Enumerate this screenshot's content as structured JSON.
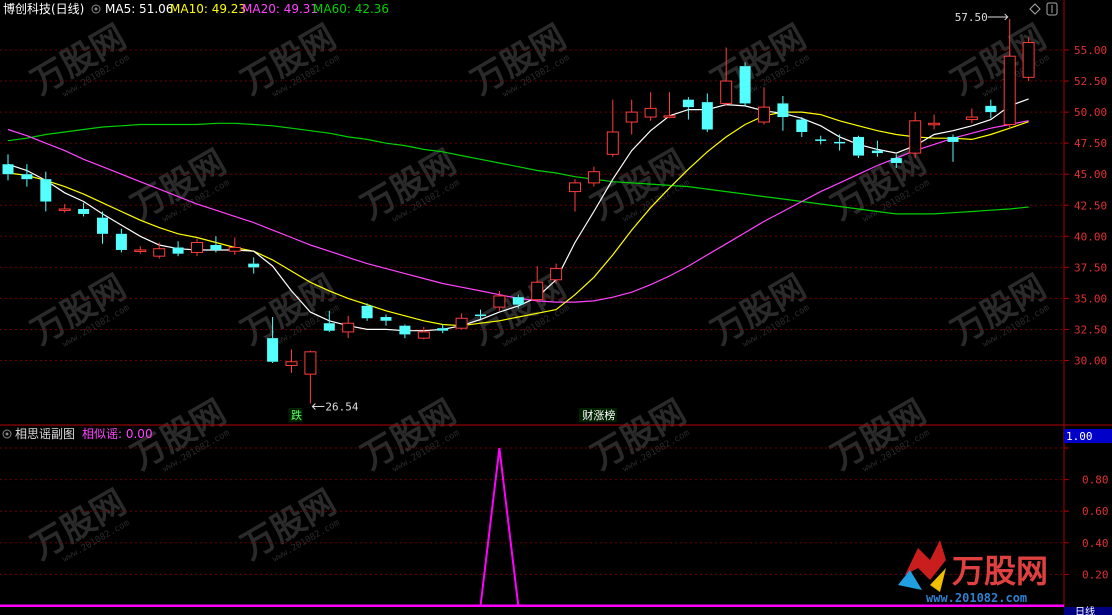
{
  "header": {
    "stock_title": "博创科技(日线)",
    "ma5_label": "MA5: 51.06",
    "ma10_label": "MA10: 49.23",
    "ma20_label": "MA20: 49.31",
    "ma60_label": "MA60: 42.36"
  },
  "sub_header": {
    "title": "相思谣副图",
    "value_label": "相似谣: 0.00"
  },
  "footer": {
    "period_label": "日线"
  },
  "watermark": {
    "brand": "万股网",
    "url": "www.201082.com"
  },
  "colors": {
    "background": "#000000",
    "up": "#ff3c3c",
    "down": "#54ffff",
    "ma5": "#ffffff",
    "ma10": "#ffff00",
    "ma20": "#ff44ff",
    "ma60": "#00d200",
    "axis_red": "#b00000",
    "sub_line": "#ff00ff"
  },
  "chart_data": [
    {
      "type": "candlestick",
      "title": "博创科技(日线)",
      "y_ticks": [
        "55.00",
        "52.50",
        "50.00",
        "47.50",
        "45.00",
        "42.50",
        "40.00",
        "37.50",
        "35.00",
        "32.50",
        "30.00"
      ],
      "ylim": [
        27.5,
        57.5
      ],
      "candles": [
        {
          "o": 45.8,
          "c": 45.0,
          "h": 46.6,
          "l": 44.5
        },
        {
          "o": 45.0,
          "c": 44.6,
          "h": 45.8,
          "l": 44.0
        },
        {
          "o": 44.6,
          "c": 42.8,
          "h": 45.2,
          "l": 42.0
        },
        {
          "o": 42.2,
          "c": 42.2,
          "h": 42.6,
          "l": 41.9
        },
        {
          "o": 42.2,
          "c": 41.8,
          "h": 42.7,
          "l": 41.6
        },
        {
          "o": 41.5,
          "c": 40.2,
          "h": 42.0,
          "l": 39.4
        },
        {
          "o": 40.2,
          "c": 38.9,
          "h": 40.6,
          "l": 38.7
        },
        {
          "o": 38.9,
          "c": 38.9,
          "h": 39.2,
          "l": 38.6
        },
        {
          "o": 38.4,
          "c": 39.0,
          "h": 39.5,
          "l": 38.2
        },
        {
          "o": 39.1,
          "c": 38.6,
          "h": 39.6,
          "l": 38.4
        },
        {
          "o": 38.7,
          "c": 39.5,
          "h": 39.8,
          "l": 38.4
        },
        {
          "o": 39.3,
          "c": 38.9,
          "h": 40.0,
          "l": 38.7
        },
        {
          "o": 38.8,
          "c": 39.1,
          "h": 39.9,
          "l": 38.5
        },
        {
          "o": 37.8,
          "c": 37.5,
          "h": 38.3,
          "l": 37.0
        },
        {
          "o": 31.8,
          "c": 29.9,
          "h": 33.5,
          "l": 29.8
        },
        {
          "o": 29.6,
          "c": 29.9,
          "h": 30.9,
          "l": 29.0
        },
        {
          "o": 28.9,
          "c": 30.7,
          "h": 30.8,
          "l": 26.54
        },
        {
          "o": 33.0,
          "c": 32.4,
          "h": 34.0,
          "l": 32.3
        },
        {
          "o": 32.3,
          "c": 33.0,
          "h": 33.6,
          "l": 31.8
        },
        {
          "o": 34.4,
          "c": 33.4,
          "h": 34.6,
          "l": 33.2
        },
        {
          "o": 33.5,
          "c": 33.2,
          "h": 33.7,
          "l": 32.8
        },
        {
          "o": 32.8,
          "c": 32.1,
          "h": 32.9,
          "l": 31.8
        },
        {
          "o": 31.8,
          "c": 32.3,
          "h": 32.7,
          "l": 31.7
        },
        {
          "o": 32.6,
          "c": 32.4,
          "h": 32.9,
          "l": 32.2
        },
        {
          "o": 32.6,
          "c": 33.4,
          "h": 33.8,
          "l": 32.5
        },
        {
          "o": 33.7,
          "c": 33.6,
          "h": 34.1,
          "l": 33.3
        },
        {
          "o": 34.3,
          "c": 35.2,
          "h": 35.6,
          "l": 34.0
        },
        {
          "o": 35.1,
          "c": 34.5,
          "h": 35.3,
          "l": 34.2
        },
        {
          "o": 34.9,
          "c": 36.3,
          "h": 37.6,
          "l": 34.7
        },
        {
          "o": 36.5,
          "c": 37.4,
          "h": 37.8,
          "l": 36.2
        },
        {
          "o": 43.6,
          "c": 44.3,
          "h": 44.6,
          "l": 42.0
        },
        {
          "o": 44.3,
          "c": 45.2,
          "h": 45.6,
          "l": 44.0
        },
        {
          "o": 46.6,
          "c": 48.4,
          "h": 51.0,
          "l": 46.4
        },
        {
          "o": 49.2,
          "c": 50.0,
          "h": 51.0,
          "l": 48.2
        },
        {
          "o": 49.6,
          "c": 50.3,
          "h": 51.6,
          "l": 49.3
        },
        {
          "o": 49.6,
          "c": 49.7,
          "h": 51.6,
          "l": 49.5
        },
        {
          "o": 51.0,
          "c": 50.4,
          "h": 51.2,
          "l": 49.4
        },
        {
          "o": 50.8,
          "c": 48.6,
          "h": 51.5,
          "l": 48.4
        },
        {
          "o": 50.7,
          "c": 52.5,
          "h": 55.2,
          "l": 50.5
        },
        {
          "o": 53.7,
          "c": 50.7,
          "h": 54.0,
          "l": 50.5
        },
        {
          "o": 49.2,
          "c": 50.4,
          "h": 52.0,
          "l": 49.0
        },
        {
          "o": 50.7,
          "c": 49.6,
          "h": 51.3,
          "l": 48.5
        },
        {
          "o": 49.4,
          "c": 48.4,
          "h": 49.6,
          "l": 48.0
        },
        {
          "o": 47.8,
          "c": 47.7,
          "h": 48.1,
          "l": 47.4
        },
        {
          "o": 47.6,
          "c": 47.5,
          "h": 48.2,
          "l": 46.9
        },
        {
          "o": 48.0,
          "c": 46.5,
          "h": 48.1,
          "l": 46.3
        },
        {
          "o": 46.9,
          "c": 46.7,
          "h": 47.7,
          "l": 46.4
        },
        {
          "o": 46.3,
          "c": 45.9,
          "h": 46.6,
          "l": 45.5
        },
        {
          "o": 46.7,
          "c": 49.3,
          "h": 50.0,
          "l": 46.3
        },
        {
          "o": 49.1,
          "c": 49.1,
          "h": 49.8,
          "l": 48.6
        },
        {
          "o": 48.0,
          "c": 47.6,
          "h": 48.2,
          "l": 46.0
        },
        {
          "o": 49.4,
          "c": 49.6,
          "h": 50.3,
          "l": 49.1
        },
        {
          "o": 50.5,
          "c": 50.0,
          "h": 51.0,
          "l": 49.5
        },
        {
          "o": 49.0,
          "c": 54.5,
          "h": 57.5,
          "l": 48.7
        },
        {
          "o": 52.8,
          "c": 55.6,
          "h": 56.0,
          "l": 52.5
        }
      ],
      "ma5": [
        45.8,
        45.3,
        44.5,
        43.5,
        42.8,
        41.8,
        40.9,
        40.0,
        39.3,
        39.0,
        38.9,
        38.9,
        38.9,
        38.8,
        37.6,
        35.6,
        33.9,
        33.2,
        32.8,
        32.5,
        32.5,
        32.4,
        32.4,
        32.5,
        32.8,
        33.3,
        33.9,
        34.4,
        35.1,
        36.5,
        39.5,
        42.0,
        44.6,
        46.9,
        48.5,
        49.7,
        50.2,
        50.2,
        50.6,
        50.5,
        50.1,
        49.9,
        49.5,
        48.9,
        48.0,
        47.4,
        47.0,
        46.7,
        47.3,
        48.2,
        48.5,
        48.9,
        49.4,
        50.5,
        51.06
      ],
      "ma10": [
        45.1,
        44.9,
        44.5,
        44.0,
        43.4,
        42.7,
        42.0,
        41.3,
        40.7,
        40.2,
        39.9,
        39.5,
        39.1,
        38.8,
        38.1,
        37.2,
        36.3,
        35.6,
        35.0,
        34.5,
        34.0,
        33.6,
        33.2,
        32.9,
        32.8,
        33.0,
        33.2,
        33.5,
        33.8,
        34.1,
        35.3,
        36.7,
        38.5,
        40.5,
        42.3,
        43.9,
        45.4,
        46.8,
        48.0,
        49.0,
        49.7,
        50.0,
        50.0,
        49.8,
        49.3,
        48.9,
        48.5,
        48.2,
        48.0,
        47.9,
        47.9,
        47.8,
        48.2,
        48.7,
        49.23
      ],
      "ma20": [
        48.6,
        48.1,
        47.5,
        46.9,
        46.2,
        45.6,
        45.0,
        44.4,
        43.8,
        43.2,
        42.6,
        42.1,
        41.6,
        41.1,
        40.5,
        39.9,
        39.3,
        38.8,
        38.3,
        37.8,
        37.4,
        37.0,
        36.6,
        36.2,
        35.9,
        35.6,
        35.3,
        35.0,
        34.8,
        34.7,
        34.7,
        34.8,
        35.1,
        35.5,
        36.1,
        36.8,
        37.6,
        38.5,
        39.4,
        40.3,
        41.2,
        42.0,
        42.8,
        43.6,
        44.3,
        45.0,
        45.7,
        46.3,
        46.9,
        47.4,
        47.9,
        48.3,
        48.7,
        49.0,
        49.31
      ],
      "ma60": [
        47.7,
        47.9,
        48.2,
        48.4,
        48.6,
        48.8,
        48.9,
        49.0,
        49.0,
        49.0,
        49.0,
        49.1,
        49.1,
        49.0,
        48.9,
        48.7,
        48.5,
        48.3,
        48.0,
        47.8,
        47.5,
        47.3,
        47.0,
        46.8,
        46.5,
        46.2,
        45.9,
        45.6,
        45.3,
        45.1,
        44.8,
        44.6,
        44.4,
        44.3,
        44.2,
        44.1,
        44.0,
        43.8,
        43.6,
        43.4,
        43.2,
        43.0,
        42.8,
        42.6,
        42.4,
        42.2,
        42.0,
        41.8,
        41.8,
        41.8,
        41.9,
        42.0,
        42.1,
        42.2,
        42.36
      ],
      "annotations": [
        {
          "candle": 16,
          "text": "26.54"
        },
        {
          "candle": 53,
          "text": "57.50"
        }
      ],
      "markers": [
        {
          "candle": 15,
          "text": "跌"
        },
        {
          "candle": 31,
          "text": "财涨榜"
        }
      ]
    },
    {
      "type": "line",
      "title": "相思谣副图",
      "series_name": "相似谣",
      "y_ticks": [
        "0.20",
        "0.40",
        "0.60",
        "0.80",
        "1.00"
      ],
      "ylim": [
        0,
        1.1
      ],
      "current_value_label": "1.00",
      "values": [
        0,
        0,
        0,
        0,
        0,
        0,
        0,
        0,
        0,
        0,
        0,
        0,
        0,
        0,
        0,
        0,
        0,
        0,
        0,
        0,
        0,
        0,
        0,
        0,
        0,
        0,
        1,
        0,
        0,
        0,
        0,
        0,
        0,
        0,
        0,
        0,
        0,
        0,
        0,
        0,
        0,
        0,
        0,
        0,
        0,
        0,
        0,
        0,
        0,
        0,
        0,
        0,
        0,
        0,
        0
      ]
    }
  ]
}
